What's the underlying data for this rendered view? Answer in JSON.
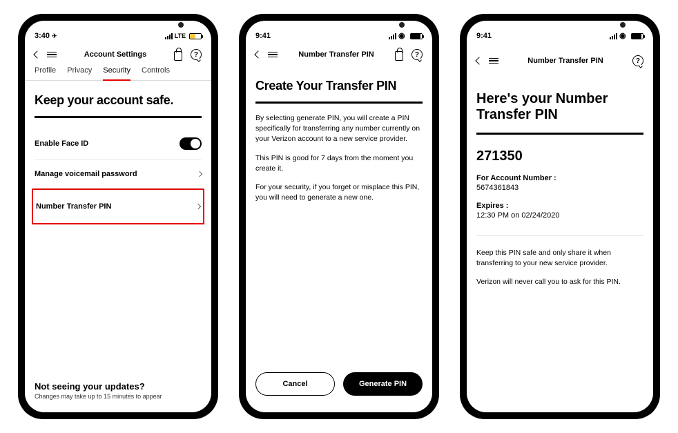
{
  "phone1": {
    "status": {
      "time": "3:40",
      "loc_arrow": "➤",
      "network": "LTE"
    },
    "nav": {
      "title": "Account Settings"
    },
    "tabs": [
      "Profile",
      "Privacy",
      "Security",
      "Controls"
    ],
    "active_tab_index": 2,
    "h1": "Keep your account safe.",
    "rows": {
      "face_id": "Enable Face ID",
      "voicemail": "Manage voicemail password",
      "ntp": "Number Transfer PIN"
    },
    "footer": {
      "title": "Not seeing your updates?",
      "sub": "Changes may take up to 15 minutes to appear"
    }
  },
  "phone2": {
    "status": {
      "time": "9:41"
    },
    "nav": {
      "title": "Number Transfer PIN"
    },
    "h1": "Create Your Transfer PIN",
    "p1": "By selecting generate PIN, you will create a PIN specifically for transferring any number currently on your Verizon account to a new service provider.",
    "p2": "This PIN is good for 7 days from the moment you create it.",
    "p3": "For your security, if you forget or misplace this PIN, you will need to generate a new one.",
    "buttons": {
      "cancel": "Cancel",
      "generate": "Generate PIN"
    }
  },
  "phone3": {
    "status": {
      "time": "9:41"
    },
    "nav": {
      "title": "Number Transfer PIN"
    },
    "h1": "Here's your Number Transfer PIN",
    "pin": "271350",
    "acct_label": "For Account Number :",
    "acct_value": "5674361843",
    "exp_label": "Expires :",
    "exp_value": "12:30 PM on 02/24/2020",
    "p1": "Keep this PIN safe and only share it when transferring to your new service provider.",
    "p2": "Verizon will never call you to ask for this PIN."
  }
}
